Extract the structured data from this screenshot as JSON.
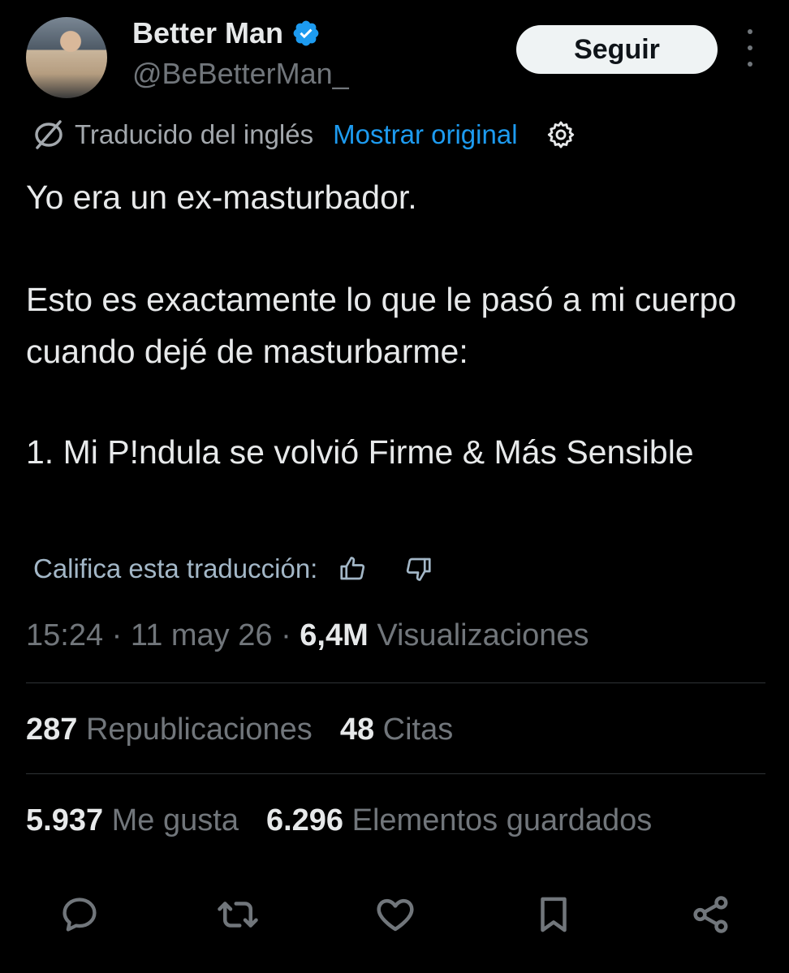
{
  "header": {
    "name": "Better Man",
    "handle": "@BeBetterMan_",
    "follow_label": "Seguir"
  },
  "translation": {
    "label": "Traducido del inglés",
    "show_original": "Mostrar original"
  },
  "tweet": {
    "p1": "Yo era un ex-masturbador.",
    "p2": "Esto es exactamente lo que le pasó a mi cuerpo cuando dejé de masturbarme:",
    "p3": "1. Mi P!ndula se volvió Firme & Más Sensible"
  },
  "rate": {
    "label": "Califica esta traducción:"
  },
  "meta": {
    "time": "15:24",
    "date": "11 may 26",
    "views_count": "6,4M",
    "views_label": "Visualizaciones"
  },
  "stats": {
    "reposts_count": "287",
    "reposts_label": "Republicaciones",
    "quotes_count": "48",
    "quotes_label": "Citas",
    "likes_count": "5.937",
    "likes_label": "Me gusta",
    "bookmarks_count": "6.296",
    "bookmarks_label": "Elementos guardados"
  },
  "colors": {
    "background": "#000000",
    "text": "#e7e9ea",
    "muted": "#71767b",
    "link": "#1d9bf0",
    "verified": "#1d9bf0"
  },
  "icons": [
    "verified-badge-icon",
    "more-icon",
    "translate-icon",
    "gear-icon",
    "thumbs-up-icon",
    "thumbs-down-icon",
    "reply-icon",
    "repost-icon",
    "like-icon",
    "bookmark-icon",
    "share-icon"
  ]
}
